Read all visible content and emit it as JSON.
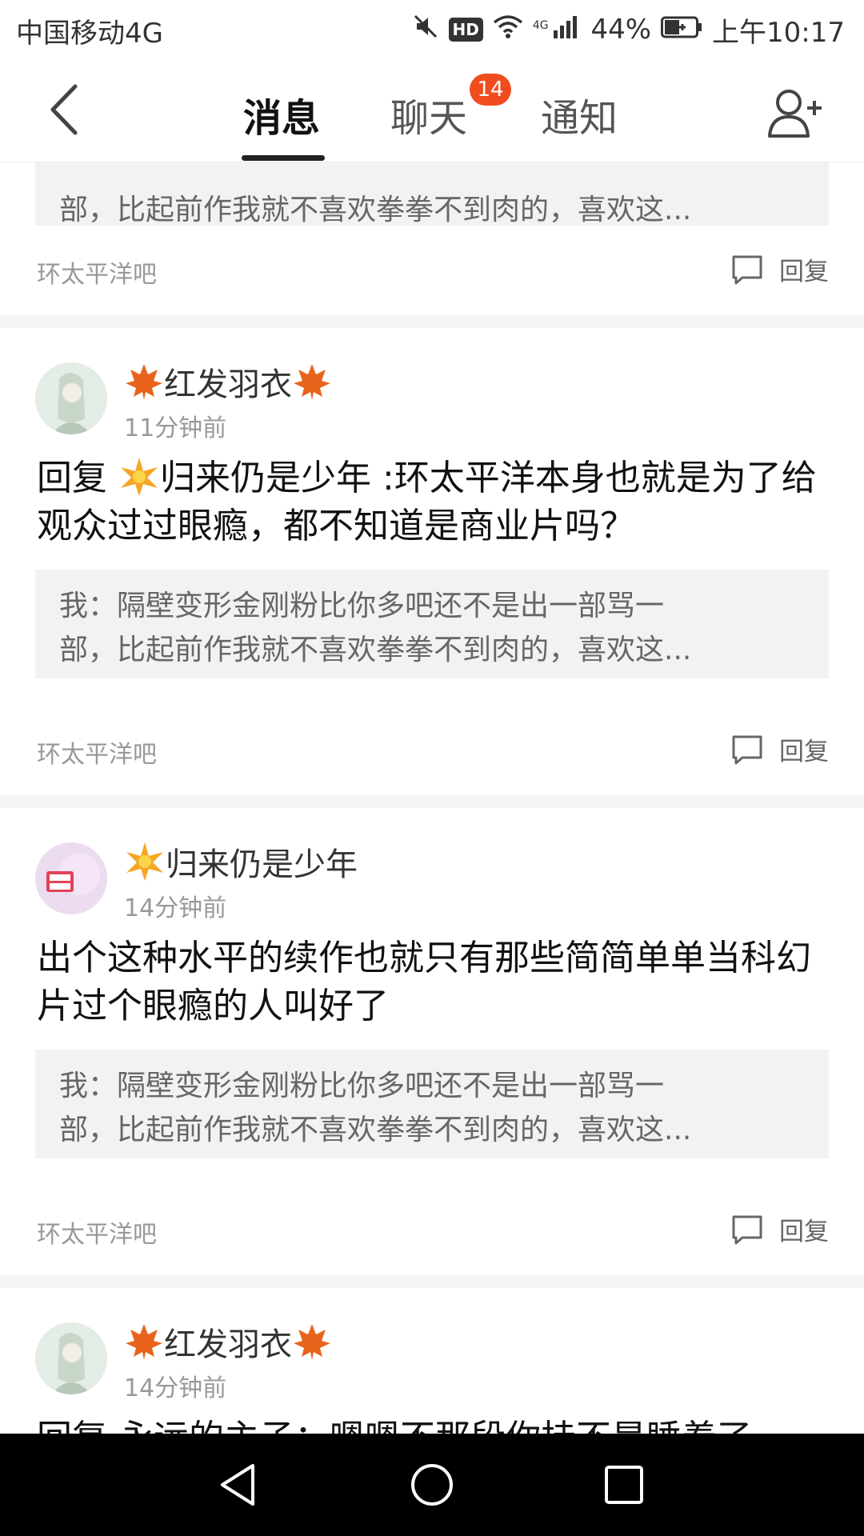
{
  "status_bar": {
    "carrier": "中国移动4G",
    "signal_label": "4G",
    "battery": "44%",
    "time": "上午10:17"
  },
  "nav": {
    "tabs": [
      {
        "label": "消息",
        "active": true
      },
      {
        "label": "聊天",
        "badge": "14"
      },
      {
        "label": "通知"
      }
    ]
  },
  "feed": {
    "top_partial": {
      "quote_line2": "部，比起前作我就不喜欢拳拳不到肉的，喜欢这...",
      "forum": "环太平洋吧",
      "reply_label": "回复"
    },
    "cards": [
      {
        "username": "红发羽衣",
        "time": "11分钟前",
        "content_prefix": "回复 ",
        "content_mention": "归来仍是少年",
        "content_rest": " :环太平洋本身也就是为了给观众过过眼瘾，都不知道是商业片吗？",
        "quote_line1": "我：隔壁变形金刚粉比你多吧还不是出一部骂一",
        "quote_line2": "部，比起前作我就不喜欢拳拳不到肉的，喜欢这...",
        "forum": "环太平洋吧",
        "reply_label": "回复"
      },
      {
        "username": "归来仍是少年",
        "time": "14分钟前",
        "content": "出个这种水平的续作也就只有那些简简单单当科幻片过个眼瘾的人叫好了",
        "quote_line1": "我：隔壁变形金刚粉比你多吧还不是出一部骂一",
        "quote_line2": "部，比起前作我就不喜欢拳拳不到肉的，喜欢这...",
        "forum": "环太平洋吧",
        "reply_label": "回复"
      },
      {
        "username": "红发羽衣",
        "time": "14分钟前",
        "content": "回复 永远的主子：嗯嗯不那段你挂不是睡着了"
      }
    ]
  },
  "colors": {
    "badge": "#ef4d1f",
    "quote_bg": "#f2f2f2",
    "divider_bg": "#f4f4f4",
    "leaf": "#e8641c",
    "star": "#f5a623"
  }
}
